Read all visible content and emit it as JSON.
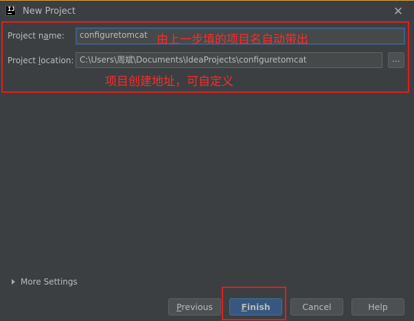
{
  "window": {
    "title": "New Project",
    "close_glyph": "✕",
    "app_icon_glyph": "IJ"
  },
  "form": {
    "name_label_pre": "Project n",
    "name_label_mn": "a",
    "name_label_post": "me:",
    "name_value": "configuretomcat",
    "location_label_pre": "Project ",
    "location_label_mn": "l",
    "location_label_post": "ocation:",
    "location_value": "C:\\Users\\周斌\\Documents\\IdeaProjects\\configuretomcat",
    "browse_label": "..."
  },
  "annotations": {
    "name_note": "由上一步填的项目名自动带出",
    "location_note": "项目创建地址，可自定义"
  },
  "more_settings": "More Settings",
  "buttons": {
    "previous_mn": "P",
    "previous_rest": "revious",
    "finish_mn": "F",
    "finish_rest": "inish",
    "cancel": "Cancel",
    "help": "Help"
  },
  "colors": {
    "accent_red": "#e31e1e",
    "focus_blue": "#3d6185",
    "default_button": "#365880"
  }
}
